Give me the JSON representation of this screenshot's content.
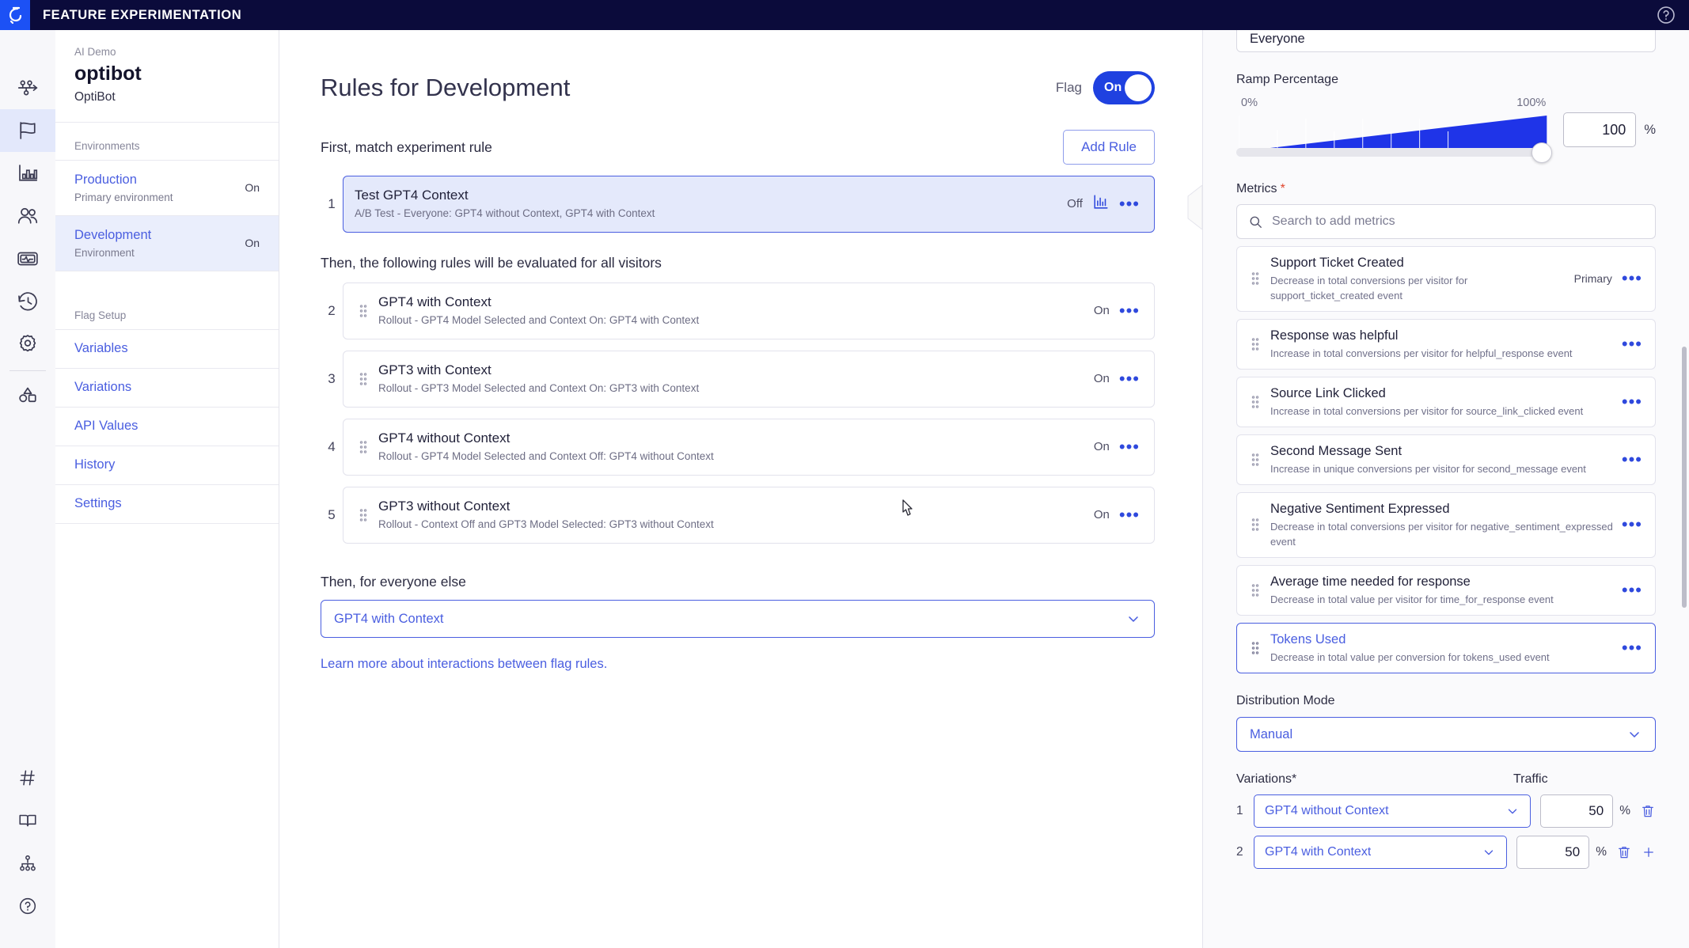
{
  "topbar": {
    "title": "FEATURE EXPERIMENTATION",
    "logo_icon": "optimizely-logo-icon",
    "help_icon": "help-circle-icon"
  },
  "rail": {
    "items": [
      {
        "icon": "flow-arrow-icon",
        "name": "sidebar-item-flows",
        "active": false
      },
      {
        "icon": "flag-icon",
        "name": "sidebar-item-flags",
        "active": true
      },
      {
        "icon": "bar-chart-icon",
        "name": "sidebar-item-reports",
        "active": false
      },
      {
        "icon": "audiences-people-icon",
        "name": "sidebar-item-audiences",
        "active": false
      },
      {
        "icon": "monitor-pulse-icon",
        "name": "sidebar-item-monitoring",
        "active": false
      },
      {
        "icon": "history-clock-icon",
        "name": "sidebar-item-history",
        "active": false
      },
      {
        "icon": "gear-icon",
        "name": "sidebar-item-settings",
        "active": false
      },
      {
        "icon": "shapes-icon",
        "name": "sidebar-item-shapes",
        "active": false
      }
    ],
    "bottom_items": [
      {
        "icon": "hash-icon",
        "name": "sidebar-item-channels"
      },
      {
        "icon": "book-icon",
        "name": "sidebar-item-docs"
      },
      {
        "icon": "sitemap-icon",
        "name": "sidebar-item-org"
      },
      {
        "icon": "help-circle-icon",
        "name": "sidebar-item-help"
      }
    ]
  },
  "flag_panel": {
    "project": "AI Demo",
    "flag_name": "optibot",
    "flag_description": "OptiBot",
    "environments_label": "Environments",
    "environments": [
      {
        "name": "Production",
        "sub": "Primary environment",
        "state": "On",
        "selected": false
      },
      {
        "name": "Development",
        "sub": "Environment",
        "state": "On",
        "selected": true
      }
    ],
    "flag_setup_label": "Flag Setup",
    "setup_links": [
      {
        "label": "Variables"
      },
      {
        "label": "Variations"
      },
      {
        "label": "API Values"
      },
      {
        "label": "History"
      },
      {
        "label": "Settings"
      }
    ]
  },
  "rules": {
    "title": "Rules for Development",
    "flag_toggle_label": "Flag",
    "flag_toggle_state": "On",
    "first_section_label": "First, match experiment rule",
    "add_rule_label": "Add Rule",
    "experiment_rules": [
      {
        "num": "1",
        "name": "Test GPT4 Context",
        "desc": "A/B Test - Everyone: GPT4 without Context, GPT4 with Context",
        "state": "Off",
        "has_chart_icon": true,
        "highlight": true
      }
    ],
    "second_section_label": "Then, the following rules will be evaluated for all visitors",
    "rollout_rules": [
      {
        "num": "2",
        "name": "GPT4 with Context",
        "desc": "Rollout - GPT4 Model Selected and Context On: GPT4 with Context",
        "state": "On"
      },
      {
        "num": "3",
        "name": "GPT3 with Context",
        "desc": "Rollout - GPT3 Model Selected and Context On: GPT3 with Context",
        "state": "On"
      },
      {
        "num": "4",
        "name": "GPT4 without Context",
        "desc": "Rollout - GPT4 Model Selected and Context Off: GPT4 without Context",
        "state": "On"
      },
      {
        "num": "5",
        "name": "GPT3 without Context",
        "desc": "Rollout - Context Off and GPT3 Model Selected: GPT3 without Context",
        "state": "On"
      }
    ],
    "everyone_else_label": "Then, for everyone else",
    "everyone_else_value": "GPT4 with Context",
    "learn_more_link": "Learn more about interactions between flag rules."
  },
  "detail": {
    "audience_value": "Everyone",
    "ramp_label": "Ramp Percentage",
    "ramp_min_tick": "0%",
    "ramp_max_tick": "100%",
    "ramp_value": "100",
    "ramp_unit": "%",
    "metrics_label": "Metrics",
    "metrics_required": "*",
    "metrics_search_placeholder": "Search to add metrics",
    "metrics": [
      {
        "name": "Support Ticket Created",
        "desc": "Decrease in total conversions per visitor for support_ticket_created event",
        "badge": "Primary",
        "selected": false
      },
      {
        "name": "Response was helpful",
        "desc": "Increase in total conversions per visitor for helpful_response event",
        "badge": "",
        "selected": false
      },
      {
        "name": "Source Link Clicked",
        "desc": "Increase in total conversions per visitor for source_link_clicked event",
        "badge": "",
        "selected": false
      },
      {
        "name": "Second Message Sent",
        "desc": "Increase in unique conversions per visitor for second_message event",
        "badge": "",
        "selected": false
      },
      {
        "name": "Negative Sentiment Expressed",
        "desc": "Decrease in total conversions per visitor for negative_sentiment_expressed event",
        "badge": "",
        "selected": false
      },
      {
        "name": "Average time needed for response",
        "desc": "Decrease in total value per visitor for time_for_response event",
        "badge": "",
        "selected": false
      },
      {
        "name": "Tokens Used",
        "desc": "Decrease in total value per conversion for tokens_used event",
        "badge": "",
        "selected": true
      }
    ],
    "distribution_label": "Distribution Mode",
    "distribution_value": "Manual",
    "variations_label": "Variations",
    "variations_required": "*",
    "traffic_label": "Traffic",
    "variations": [
      {
        "num": "1",
        "value": "GPT4 without Context",
        "traffic": "50",
        "unit": "%"
      },
      {
        "num": "2",
        "value": "GPT4 with Context",
        "traffic": "50",
        "unit": "%"
      }
    ]
  },
  "colors": {
    "brand_blue": "#1f41e0",
    "link_blue": "#4a5ee0",
    "topbar_navy": "#0b0b3b",
    "required_red": "#e0452c"
  }
}
